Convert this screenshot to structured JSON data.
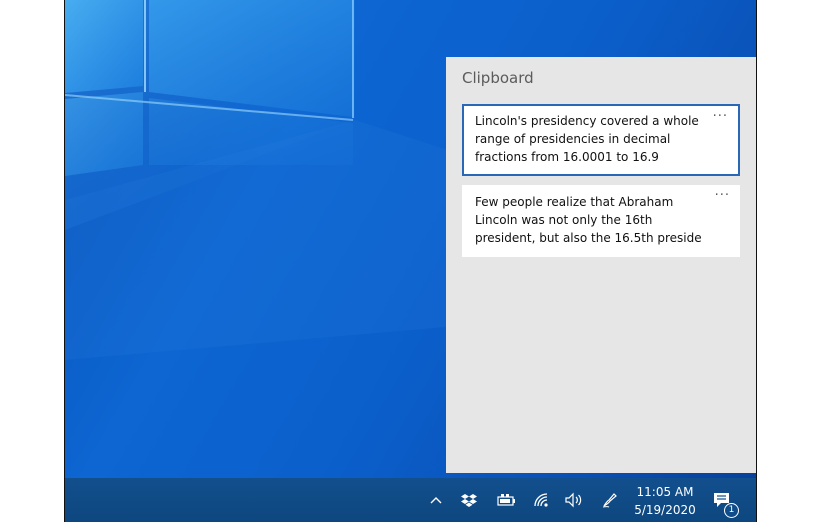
{
  "clipboard": {
    "title": "Clipboard",
    "items": [
      {
        "text": "Lincoln's presidency covered a whole range of presidencies in decimal fractions from 16.0001 to 16.9",
        "more": "···",
        "selected": true
      },
      {
        "text": "Few people realize that Abraham Lincoln was not only the 16th president, but also the 16.5th preside",
        "more": "···",
        "selected": false
      }
    ]
  },
  "taskbar": {
    "time": "11:05 AM",
    "date": "5/19/2020",
    "notification_count": "1",
    "icons": [
      "chevron-up-icon",
      "dropbox-icon",
      "battery-icon",
      "wifi-icon",
      "volume-icon",
      "pen-icon",
      "action-center-icon"
    ]
  },
  "colors": {
    "wallpaper_blue": "#0b5fcb",
    "panel_bg": "#e6e6e6",
    "selection_border": "#2a67b5",
    "taskbar_bg": "#0f4d8a"
  }
}
